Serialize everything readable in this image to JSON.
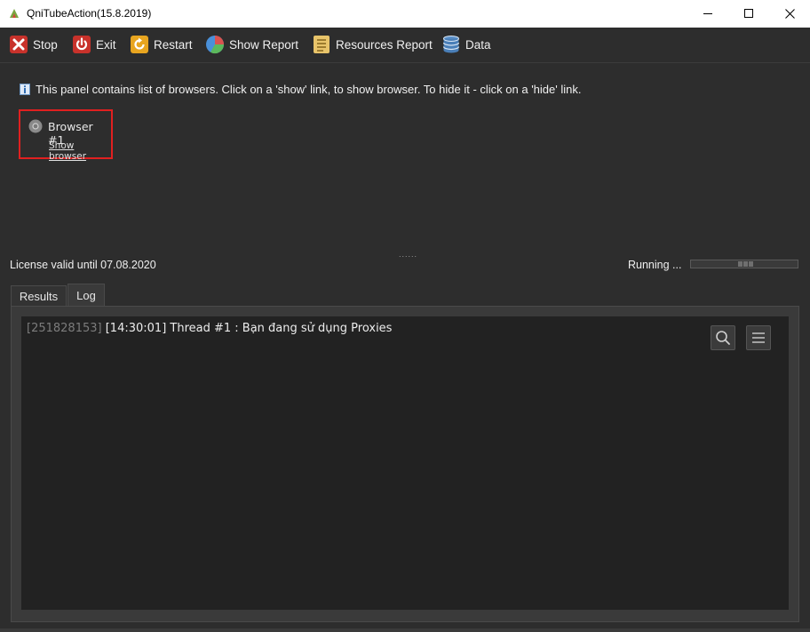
{
  "window": {
    "title": "QniTubeAction(15.8.2019)",
    "controls": {
      "minimize": "minimize-icon",
      "maximize": "maximize-icon",
      "close": "close-icon"
    }
  },
  "toolbar": {
    "items": [
      {
        "label": "Stop",
        "icon": "stop-icon"
      },
      {
        "label": "Exit",
        "icon": "power-icon"
      },
      {
        "label": "Restart",
        "icon": "restart-icon"
      },
      {
        "label": "Show Report",
        "icon": "pie-chart-icon"
      },
      {
        "label": "Resources Report",
        "icon": "list-icon"
      },
      {
        "label": "Data",
        "icon": "database-icon"
      }
    ]
  },
  "browser_panel": {
    "info_text": "This panel contains list of browsers. Click on a 'show' link, to show browser. To hide it - click on a 'hide' link.",
    "browsers": [
      {
        "name": "Browser #1",
        "link": "Show browser"
      }
    ]
  },
  "status": {
    "license": "License valid until 07.08.2020",
    "running": "Running ...",
    "progress_state": "indeterminate"
  },
  "tabs": [
    {
      "label": "Results",
      "active": false
    },
    {
      "label": "Log",
      "active": true
    }
  ],
  "log": {
    "entries": [
      {
        "id": "[251828153]",
        "message": "[14:30:01] Thread #1 : Bạn đang sử dụng Proxies"
      }
    ],
    "tools": [
      "search-icon",
      "menu-icon"
    ]
  },
  "colors": {
    "background": "#2d2d2d",
    "log_background": "#222222",
    "highlight_border": "#e02020"
  }
}
